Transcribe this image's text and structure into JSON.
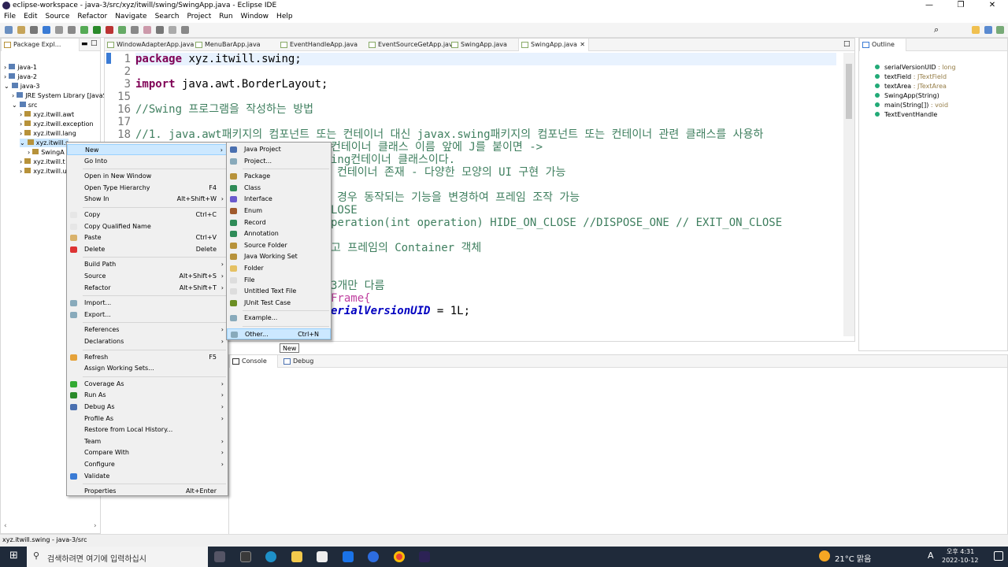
{
  "window": {
    "title": "eclipse-workspace - java-3/src/xyz/itwill/swing/SwingApp.java - Eclipse IDE",
    "minimize": "—",
    "maximize": "❐",
    "close": "✕"
  },
  "menubar": [
    "File",
    "Edit",
    "Source",
    "Refactor",
    "Navigate",
    "Search",
    "Project",
    "Run",
    "Window",
    "Help"
  ],
  "package_explorer": {
    "tab": "Package Expl...",
    "items": [
      {
        "label": "java-1",
        "indent": 0,
        "arrow": ">"
      },
      {
        "label": "java-2",
        "indent": 0,
        "arrow": ">"
      },
      {
        "label": "java-3",
        "indent": 0,
        "arrow": "v"
      },
      {
        "label": "JRE System Library [JavaS",
        "indent": 1,
        "arrow": ">"
      },
      {
        "label": "src",
        "indent": 1,
        "arrow": "v"
      },
      {
        "label": "xyz.itwill.awt",
        "indent": 2,
        "arrow": ">"
      },
      {
        "label": "xyz.itwill.exception",
        "indent": 2,
        "arrow": ">"
      },
      {
        "label": "xyz.itwill.lang",
        "indent": 2,
        "arrow": ">"
      },
      {
        "label": "xyz.itwill.s",
        "indent": 2,
        "arrow": "v"
      },
      {
        "label": "SwingA",
        "indent": 3,
        "arrow": ">"
      },
      {
        "label": "xyz.itwill.t",
        "indent": 2,
        "arrow": ">"
      },
      {
        "label": "xyz.itwill.u",
        "indent": 2,
        "arrow": ">"
      }
    ]
  },
  "editor_tabs": [
    "WindowAdapterApp.java",
    "MenuBarApp.java",
    "EventHandleApp.java",
    "EventSourceGetApp.java",
    "SwingApp.java",
    "SwingApp.java"
  ],
  "code": {
    "line_numbers": [
      "1",
      "2",
      "3",
      "15",
      "16",
      "17"
    ],
    "l1": "package xyz.itwill.swing;",
    "l3_kw": "import",
    "l3": " java.awt.BorderLayout;",
    "l16": "//Swing 프로그램을 작성하는 방법",
    "l18": "//1. java.awt패키지의 컴포넌트 또는 컨테이너 대신 javax.swing패키지의 컴포넌트 또는 컨테이너 관련 클래스를 사용하",
    "l19": "컨테이너 클래스 이름 앞에 J를 붙이면 ->",
    "l20": "ing컨테이너 클래스이다.",
    "l21": "컨테이너 존재 - 다양한 모양의 UI 구현 가능",
    "l23": "경우 동작되는 기능을 변경하여 프레임 조작 가능",
    "l24": "LOSE",
    "l25": "peration(int operation) HIDE_ON_CLOSE //DISPOSE_ONE // EXIT_ON_CLOSE",
    "l27": "고 프레임의 Container 객체",
    "l29": "3개만 다름",
    "l30": "Frame{",
    "l31a": "erialVersionUID",
    "l31b": " = 1L;"
  },
  "context_menu": [
    {
      "label": "New",
      "shortcut": "",
      "arrow": true,
      "icon": "",
      "hl": true
    },
    {
      "label": "Go Into",
      "shortcut": "",
      "arrow": false,
      "icon": ""
    },
    {
      "sep": true
    },
    {
      "label": "Open in New Window",
      "shortcut": "",
      "arrow": false,
      "icon": ""
    },
    {
      "label": "Open Type Hierarchy",
      "shortcut": "F4",
      "arrow": false,
      "icon": ""
    },
    {
      "label": "Show In",
      "shortcut": "Alt+Shift+W",
      "arrow": true,
      "icon": ""
    },
    {
      "sep": true
    },
    {
      "label": "Copy",
      "shortcut": "Ctrl+C",
      "arrow": false,
      "icon": "#e6e6e6"
    },
    {
      "label": "Copy Qualified Name",
      "shortcut": "",
      "arrow": false,
      "icon": "#e6e6e6"
    },
    {
      "label": "Paste",
      "shortcut": "Ctrl+V",
      "arrow": false,
      "icon": "#d9b26b"
    },
    {
      "label": "Delete",
      "shortcut": "Delete",
      "arrow": false,
      "icon": "#d33"
    },
    {
      "sep": true
    },
    {
      "label": "Build Path",
      "shortcut": "",
      "arrow": true,
      "icon": ""
    },
    {
      "label": "Source",
      "shortcut": "Alt+Shift+S",
      "arrow": true,
      "icon": ""
    },
    {
      "label": "Refactor",
      "shortcut": "Alt+Shift+T",
      "arrow": true,
      "icon": ""
    },
    {
      "sep": true
    },
    {
      "label": "Import...",
      "shortcut": "",
      "arrow": false,
      "icon": "#8ab"
    },
    {
      "label": "Export...",
      "shortcut": "",
      "arrow": false,
      "icon": "#8ab"
    },
    {
      "sep": true
    },
    {
      "label": "References",
      "shortcut": "",
      "arrow": true,
      "icon": ""
    },
    {
      "label": "Declarations",
      "shortcut": "",
      "arrow": true,
      "icon": ""
    },
    {
      "sep": true
    },
    {
      "label": "Refresh",
      "shortcut": "F5",
      "arrow": false,
      "icon": "#e5a23a"
    },
    {
      "label": "Assign Working Sets...",
      "shortcut": "",
      "arrow": false,
      "icon": ""
    },
    {
      "sep": true
    },
    {
      "label": "Coverage As",
      "shortcut": "",
      "arrow": true,
      "icon": "#3a3"
    },
    {
      "label": "Run As",
      "shortcut": "",
      "arrow": true,
      "icon": "#2a8a2a"
    },
    {
      "label": "Debug As",
      "shortcut": "",
      "arrow": true,
      "icon": "#4a70b0"
    },
    {
      "label": "Profile As",
      "shortcut": "",
      "arrow": true,
      "icon": ""
    },
    {
      "label": "Restore from Local History...",
      "shortcut": "",
      "arrow": false,
      "icon": ""
    },
    {
      "label": "Team",
      "shortcut": "",
      "arrow": true,
      "icon": ""
    },
    {
      "label": "Compare With",
      "shortcut": "",
      "arrow": true,
      "icon": ""
    },
    {
      "label": "Configure",
      "shortcut": "",
      "arrow": true,
      "icon": ""
    },
    {
      "label": "Validate",
      "shortcut": "",
      "arrow": false,
      "icon": "#3a7bd5"
    },
    {
      "sep": true
    },
    {
      "label": "Properties",
      "shortcut": "Alt+Enter",
      "arrow": false,
      "icon": ""
    }
  ],
  "submenu": [
    {
      "label": "Java Project",
      "icon": "#4a70b0"
    },
    {
      "label": "Project...",
      "icon": "#8ab"
    },
    {
      "sep": true
    },
    {
      "label": "Package",
      "icon": "#b7923a"
    },
    {
      "label": "Class",
      "icon": "#2e8b57"
    },
    {
      "label": "Interface",
      "icon": "#6a5acd"
    },
    {
      "label": "Enum",
      "icon": "#a05a2c"
    },
    {
      "label": "Record",
      "icon": "#2e8b57"
    },
    {
      "label": "Annotation",
      "icon": "#2e8b57"
    },
    {
      "label": "Source Folder",
      "icon": "#b7923a"
    },
    {
      "label": "Java Working Set",
      "icon": "#b7923a"
    },
    {
      "label": "Folder",
      "icon": "#e5c163"
    },
    {
      "label": "File",
      "icon": "#ddd"
    },
    {
      "label": "Untitled Text File",
      "icon": "#ddd"
    },
    {
      "label": "JUnit Test Case",
      "icon": "#6b8e23"
    },
    {
      "sep": true
    },
    {
      "label": "Example...",
      "icon": "#8ab"
    },
    {
      "sep": true
    },
    {
      "label": "Other...",
      "shortcut": "Ctrl+N",
      "icon": "#8ab",
      "hl": true
    }
  ],
  "tooltip": "New",
  "outline": {
    "tab": "Outline",
    "items": [
      {
        "name": "serialVersionUID",
        "type": " : long",
        "color": "#2a7"
      },
      {
        "name": "textField",
        "type": " : JTextField",
        "color": "#2a7"
      },
      {
        "name": "textArea",
        "type": " : JTextArea",
        "color": "#2a7"
      },
      {
        "name": "SwingApp(String)",
        "type": "",
        "color": "#2a7"
      },
      {
        "name": "main(String[])",
        "type": " : void",
        "color": "#2a7"
      },
      {
        "name": "TextEventHandle",
        "type": "",
        "color": "#2a7"
      }
    ]
  },
  "bottom_tabs": {
    "console": "Console",
    "debug": "Debug"
  },
  "status": "xyz.itwill.swing - java-3/src",
  "taskbar": {
    "search": "검색하려면 여기에 입력하십시",
    "weather": "21°C 맑음",
    "ime": "A",
    "time": "오후 4:31",
    "date": "2022-10-12"
  }
}
